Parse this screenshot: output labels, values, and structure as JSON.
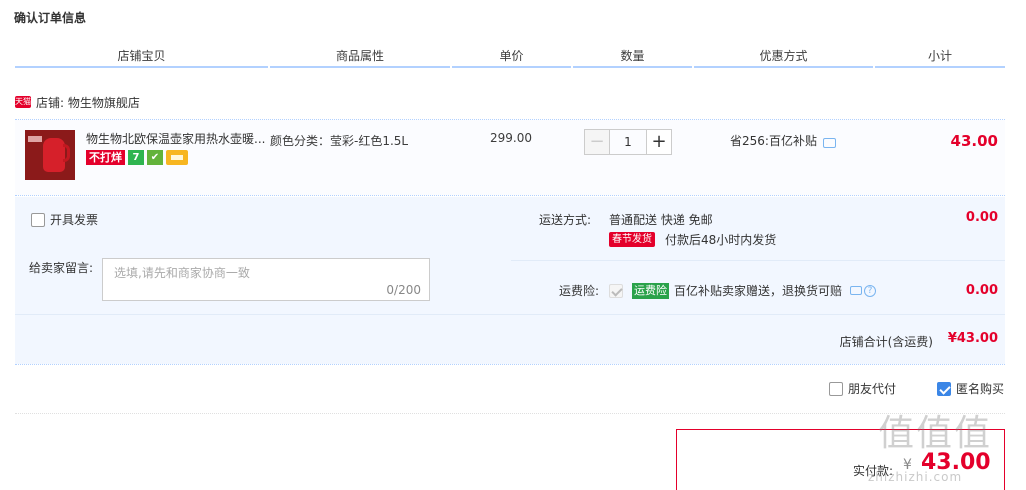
{
  "page": {
    "title": "确认订单信息"
  },
  "table_headers": [
    "店铺宝贝",
    "商品属性",
    "单价",
    "数量",
    "优惠方式",
    "小计"
  ],
  "shop": {
    "badge": "天猫",
    "label": "店铺: 物生物旗舰店"
  },
  "item": {
    "name": "物生物北欧保温壶家用热水壶暖...",
    "tags": {
      "no_discount": "不打烊",
      "seven": "7"
    },
    "attribute": "颜色分类：莹彩-红色1.5L",
    "price": "299.00",
    "quantity": "1",
    "discount": "省256:百亿补贴",
    "subtotal": "43.00"
  },
  "invoice": {
    "label": "开具发票",
    "checked": false
  },
  "memo": {
    "label": "给卖家留言:",
    "placeholder": "选填,请先和商家协商一致",
    "counter": "0/200"
  },
  "shipping": {
    "label": "运送方式:",
    "detail": "普通配送 快递 免邮",
    "tag": "春节发货",
    "note": "付款后48小时内发货",
    "fee": "0.00"
  },
  "insurance": {
    "label": "运费险:",
    "tag": "运费险",
    "text": "百亿补贴卖家赠送，退换货可赔",
    "fee": "0.00"
  },
  "shop_total": {
    "label": "店铺合计(含运费)",
    "value": "¥43.00"
  },
  "options": {
    "friend_pay": {
      "label": "朋友代付",
      "checked": false
    },
    "anonymous": {
      "label": "匿名购买",
      "checked": true
    }
  },
  "payment": {
    "label": "实付款:",
    "currency": "¥",
    "value": "43.00"
  },
  "watermark": {
    "main": "值值值",
    "sub": "zhizhizhi.com"
  },
  "colors": {
    "accent": "#e4002b",
    "border": "#b2d1ff",
    "panel": "#f2f7ff",
    "link": "#3b86e6"
  }
}
